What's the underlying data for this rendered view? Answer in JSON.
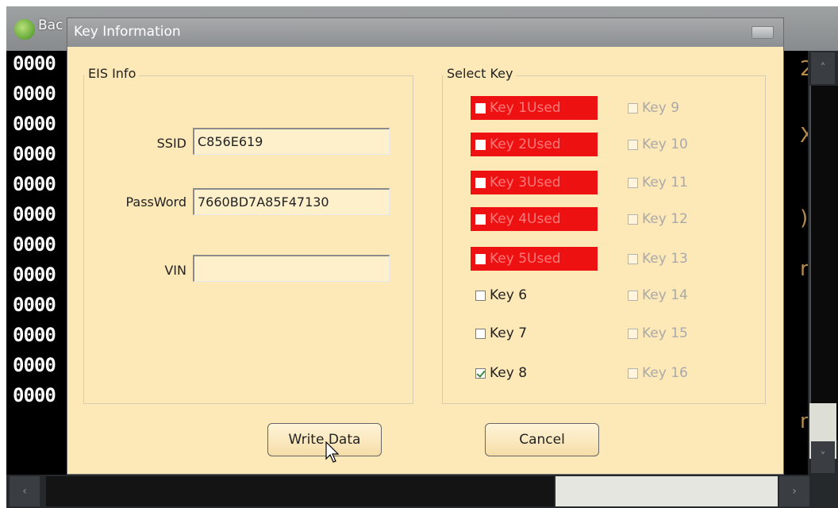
{
  "background_app": {
    "title": "Bac",
    "hex_rows": [
      "0000",
      "0000",
      "0000",
      "0000",
      "0000",
      "0000",
      "0000",
      "0000",
      "0000",
      "0000",
      "0000",
      "0000"
    ],
    "glyphs": [
      "2",
      "X",
      ")",
      "r",
      "n"
    ]
  },
  "dialog": {
    "title": "Key Information",
    "eis_info": {
      "label": "EIS Info",
      "ssid_label": "SSID",
      "ssid_value": "C856E619",
      "password_label": "PassWord",
      "password_value": "7660BD7A85F47130",
      "vin_label": "VIN",
      "vin_value": ""
    },
    "select_key": {
      "label": "Select Key",
      "left_keys": [
        {
          "label": "Key 1Used",
          "state": "used"
        },
        {
          "label": "Key 2Used",
          "state": "used"
        },
        {
          "label": "Key 3Used",
          "state": "used"
        },
        {
          "label": "Key 4Used",
          "state": "used"
        },
        {
          "label": "Key 5Used",
          "state": "used"
        },
        {
          "label": "Key 6",
          "state": "unchecked"
        },
        {
          "label": "Key 7",
          "state": "unchecked"
        },
        {
          "label": "Key 8",
          "state": "checked"
        }
      ],
      "right_keys": [
        {
          "label": "Key 9",
          "state": "disabled"
        },
        {
          "label": "Key 10",
          "state": "disabled"
        },
        {
          "label": "Key 11",
          "state": "disabled"
        },
        {
          "label": "Key 12",
          "state": "disabled"
        },
        {
          "label": "Key 13",
          "state": "disabled"
        },
        {
          "label": "Key 14",
          "state": "disabled"
        },
        {
          "label": "Key 15",
          "state": "disabled"
        },
        {
          "label": "Key 16",
          "state": "disabled"
        }
      ]
    },
    "buttons": {
      "write_data": "Write Data",
      "cancel": "Cancel"
    }
  },
  "colors": {
    "dialog_bg": "#fde8b8",
    "used_key_bg": "#ee1111",
    "titlebar": "#9a9d9f"
  }
}
